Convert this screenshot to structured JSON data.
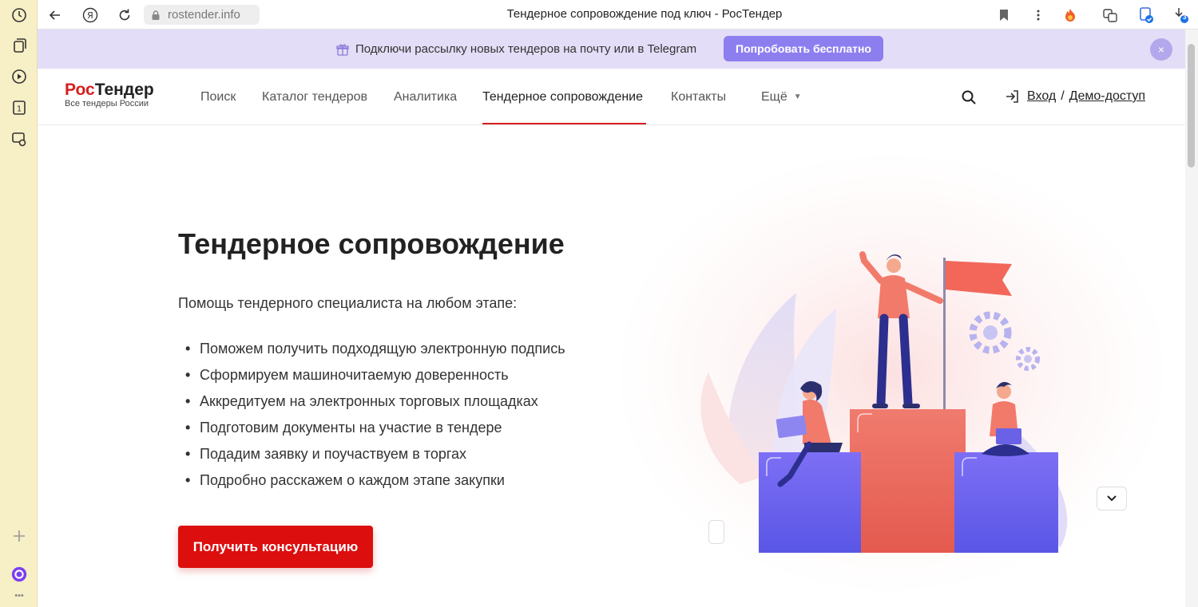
{
  "browser": {
    "url": "rostender.info",
    "tab_title": "Тендерное сопровождение под ключ - РосТендер",
    "downloads_badge": "3"
  },
  "side_panel": {
    "icons": [
      "history-icon",
      "collections-icon",
      "video-icon",
      "tab-counter-icon",
      "screenshot-icon",
      "add-icon",
      "alice-icon",
      "more-icon"
    ],
    "tab_count": "1",
    "more": "•••"
  },
  "promo": {
    "text": "Подключи рассылку новых тендеров на почту или в Telegram",
    "button": "Попробовать бесплатно",
    "close": "×"
  },
  "header": {
    "logo_part1": "Рос",
    "logo_part2": "Тендер",
    "logo_tagline": "Все тендеры России",
    "nav": [
      "Поиск",
      "Каталог тендеров",
      "Аналитика",
      "Тендерное сопровождение",
      "Контакты",
      "Ещё"
    ],
    "login": "Вход",
    "separator": "/",
    "demo": "Демо-доступ"
  },
  "hero": {
    "title": "Тендерное сопровождение",
    "subtitle": "Помощь тендерного специалиста на любом этапе:",
    "bullets": [
      "Поможем получить подходящую электронную подпись",
      "Сформируем машиночитаемую доверенность",
      "Аккредитуем на электронных торговых площадках",
      "Подготовим документы на участие в тендере",
      "Подадим заявку и поучаствуем в торгах",
      "Подробно расскажем о каждом этапе закупки"
    ],
    "cta": "Получить консультацию"
  },
  "colors": {
    "brand_red": "#d61e1e",
    "cta_red": "#dc0e0e",
    "promo_bg": "#e4ddf7",
    "promo_button": "#8d7ef0",
    "side_panel_bg": "#f7efc5"
  }
}
